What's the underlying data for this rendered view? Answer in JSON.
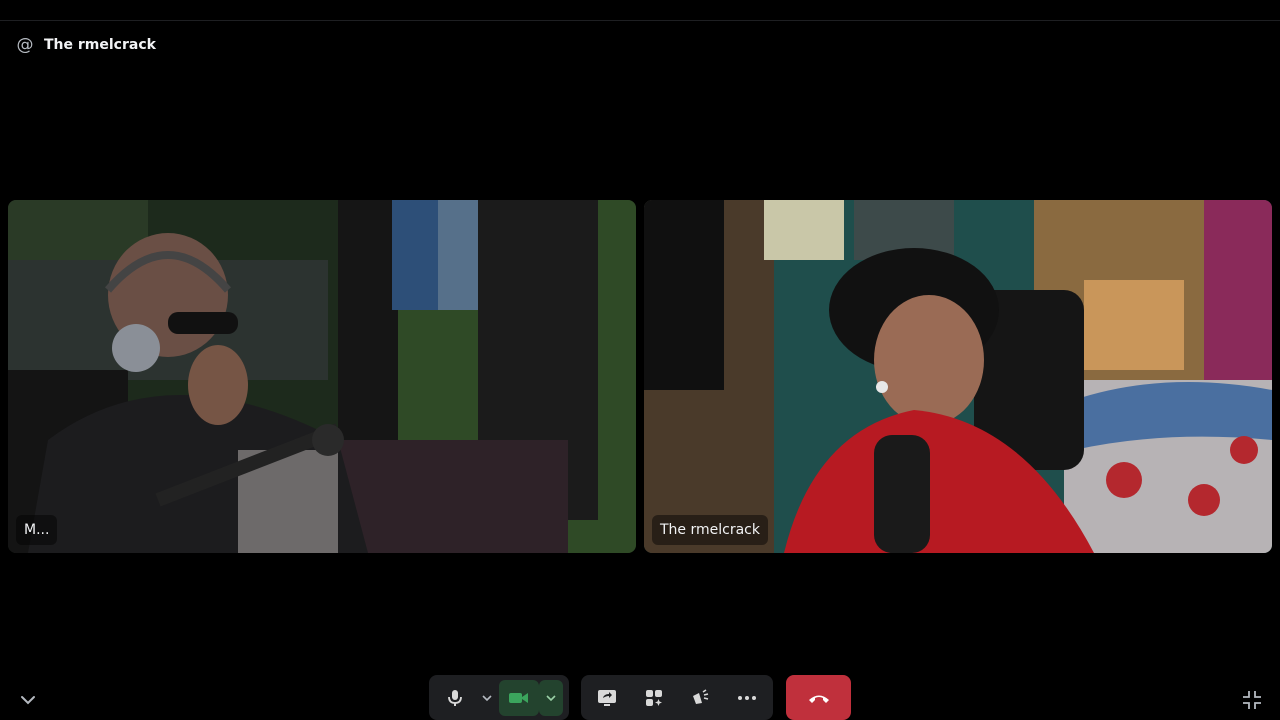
{
  "header": {
    "icon": "at-icon",
    "title": "The rmelcrack"
  },
  "participants": [
    {
      "name": "M...",
      "tile": "left"
    },
    {
      "name": "The rmelcrack",
      "tile": "right"
    }
  ],
  "controls": {
    "microphone": "microphone-icon",
    "camera": "camera-icon",
    "screen_share": "screen-share-icon",
    "activities": "activities-icon",
    "soundboard": "soundboard-icon",
    "more": "more-icon",
    "end_call": "hang-up-icon",
    "collapse": "chevron-down-icon",
    "exit_fullscreen": "exit-fullscreen-icon"
  },
  "colors": {
    "background": "#000000",
    "end_call": "#c0303c",
    "camera_active": "#23432e",
    "control_bg": "#1e1f22"
  }
}
